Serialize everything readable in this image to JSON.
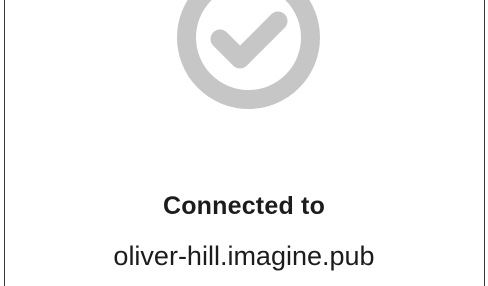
{
  "status": {
    "icon": "check-circle-icon",
    "title": "Connected to",
    "host": "oliver-hill.imagine.pub"
  },
  "colors": {
    "icon": "#c6c6c6",
    "text": "#1c1c1c",
    "background": "#ffffff"
  }
}
